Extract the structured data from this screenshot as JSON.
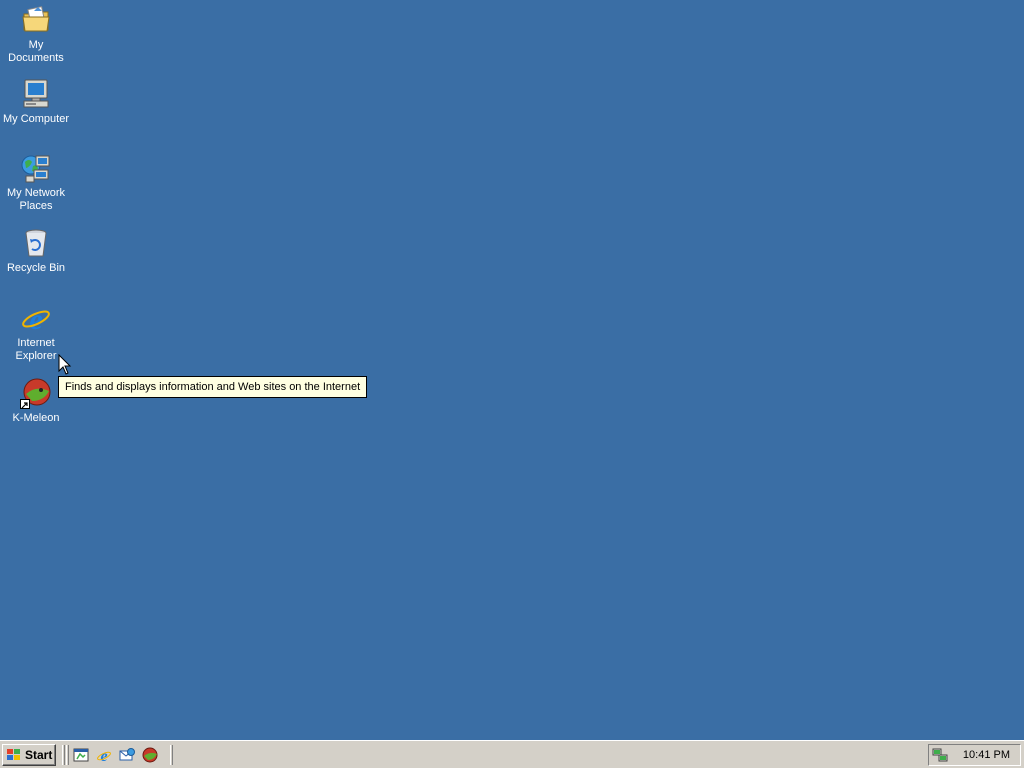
{
  "desktop": {
    "background_color": "#3a6ea5",
    "icons": [
      {
        "label": "My Documents",
        "icon": "my-documents-icon"
      },
      {
        "label": "My Computer",
        "icon": "my-computer-icon"
      },
      {
        "label": "My Network Places",
        "icon": "my-network-places-icon"
      },
      {
        "label": "Recycle Bin",
        "icon": "recycle-bin-icon"
      },
      {
        "label": "Internet Explorer",
        "icon": "internet-explorer-icon"
      },
      {
        "label": "K-Meleon",
        "icon": "k-meleon-icon"
      }
    ]
  },
  "tooltip": {
    "text": "Finds and displays information and Web sites on the Internet"
  },
  "taskbar": {
    "start_label": "Start",
    "quick_launch": [
      "show-desktop-icon",
      "internet-explorer-icon",
      "outlook-express-icon",
      "k-meleon-icon"
    ],
    "tray": {
      "icon": "network-connection-icon",
      "clock": "10:41 PM"
    }
  }
}
